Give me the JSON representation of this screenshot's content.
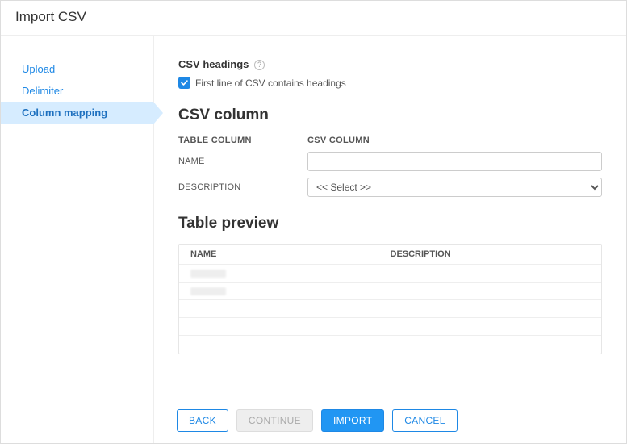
{
  "title": "Import CSV",
  "sidebar": {
    "items": [
      {
        "label": "Upload"
      },
      {
        "label": "Delimiter"
      },
      {
        "label": "Column mapping"
      }
    ]
  },
  "headings": {
    "section_label": "CSV headings",
    "checkbox_label": "First line of CSV contains headings"
  },
  "column_section": {
    "title": "CSV column",
    "table_col_header": "TABLE COLUMN",
    "csv_col_header": "CSV COLUMN",
    "rows": [
      {
        "label": "NAME",
        "select_value": ""
      },
      {
        "label": "DESCRIPTION",
        "select_value": "<< Select >>"
      }
    ]
  },
  "preview": {
    "title": "Table preview",
    "columns": [
      "NAME",
      "DESCRIPTION"
    ]
  },
  "buttons": {
    "back": "BACK",
    "continue": "CONTINUE",
    "import": "IMPORT",
    "cancel": "CANCEL"
  }
}
